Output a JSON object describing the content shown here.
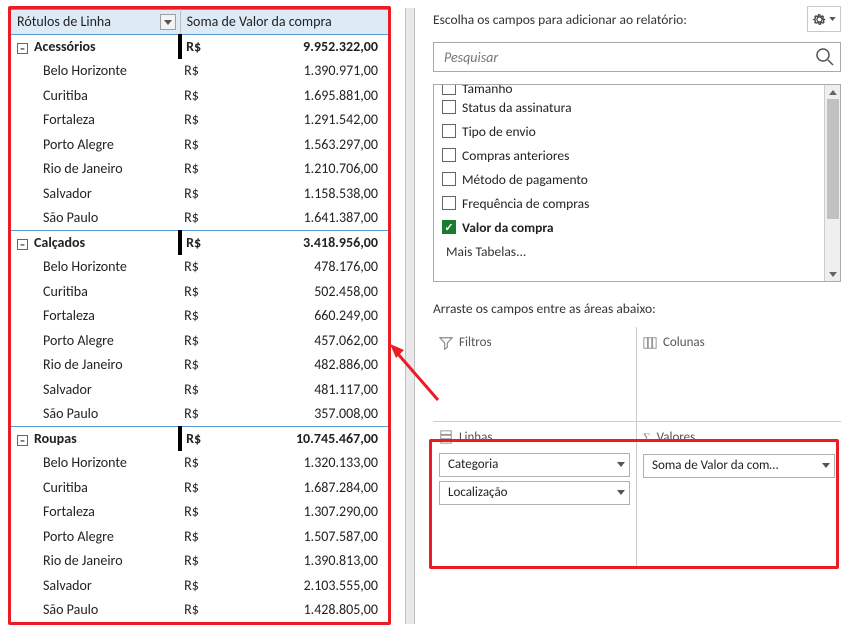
{
  "pivot": {
    "header_rowlabels": "Rótulos de Linha",
    "header_sum": "Soma de Valor da compra",
    "currency": "R$",
    "groups": [
      {
        "name": "Acessórios",
        "total": "9.952.322,00",
        "rows": [
          {
            "city": "Belo Horizonte",
            "val": "1.390.971,00"
          },
          {
            "city": "Curitiba",
            "val": "1.695.881,00"
          },
          {
            "city": "Fortaleza",
            "val": "1.291.542,00"
          },
          {
            "city": "Porto Alegre",
            "val": "1.563.297,00"
          },
          {
            "city": "Rio de Janeiro",
            "val": "1.210.706,00"
          },
          {
            "city": "Salvador",
            "val": "1.158.538,00"
          },
          {
            "city": "São Paulo",
            "val": "1.641.387,00"
          }
        ]
      },
      {
        "name": "Calçados",
        "total": "3.418.956,00",
        "rows": [
          {
            "city": "Belo Horizonte",
            "val": "478.176,00"
          },
          {
            "city": "Curitiba",
            "val": "502.458,00"
          },
          {
            "city": "Fortaleza",
            "val": "660.249,00"
          },
          {
            "city": "Porto Alegre",
            "val": "457.062,00"
          },
          {
            "city": "Rio de Janeiro",
            "val": "482.886,00"
          },
          {
            "city": "Salvador",
            "val": "481.117,00"
          },
          {
            "city": "São Paulo",
            "val": "357.008,00"
          }
        ]
      },
      {
        "name": "Roupas",
        "total": "10.745.467,00",
        "rows": [
          {
            "city": "Belo Horizonte",
            "val": "1.320.133,00"
          },
          {
            "city": "Curitiba",
            "val": "1.687.284,00"
          },
          {
            "city": "Fortaleza",
            "val": "1.307.290,00"
          },
          {
            "city": "Porto Alegre",
            "val": "1.507.587,00"
          },
          {
            "city": "Rio de Janeiro",
            "val": "1.390.813,00"
          },
          {
            "city": "Salvador",
            "val": "2.103.555,00"
          },
          {
            "city": "São Paulo",
            "val": "1.428.805,00"
          }
        ]
      }
    ]
  },
  "pane": {
    "choose_prompt": "Escolha os campos para adicionar ao relatório:",
    "search_placeholder": "Pesquisar",
    "fields_partial": "Tamanho",
    "fields": [
      {
        "label": "Status da assinatura",
        "checked": false
      },
      {
        "label": "Tipo de envio",
        "checked": false
      },
      {
        "label": "Compras anteriores",
        "checked": false
      },
      {
        "label": "Método de pagamento",
        "checked": false
      },
      {
        "label": "Frequência de compras",
        "checked": false
      },
      {
        "label": "Valor da compra",
        "checked": true
      }
    ],
    "more_tables": "Mais Tabelas...",
    "drag_prompt": "Arraste os campos entre as áreas abaixo:",
    "area_filters": "Filtros",
    "area_columns": "Colunas",
    "area_rows": "Linhas",
    "area_values": "Valores",
    "rows_pills": [
      "Categoria",
      "Localização"
    ],
    "values_pills": [
      "Soma de Valor da com…"
    ]
  }
}
